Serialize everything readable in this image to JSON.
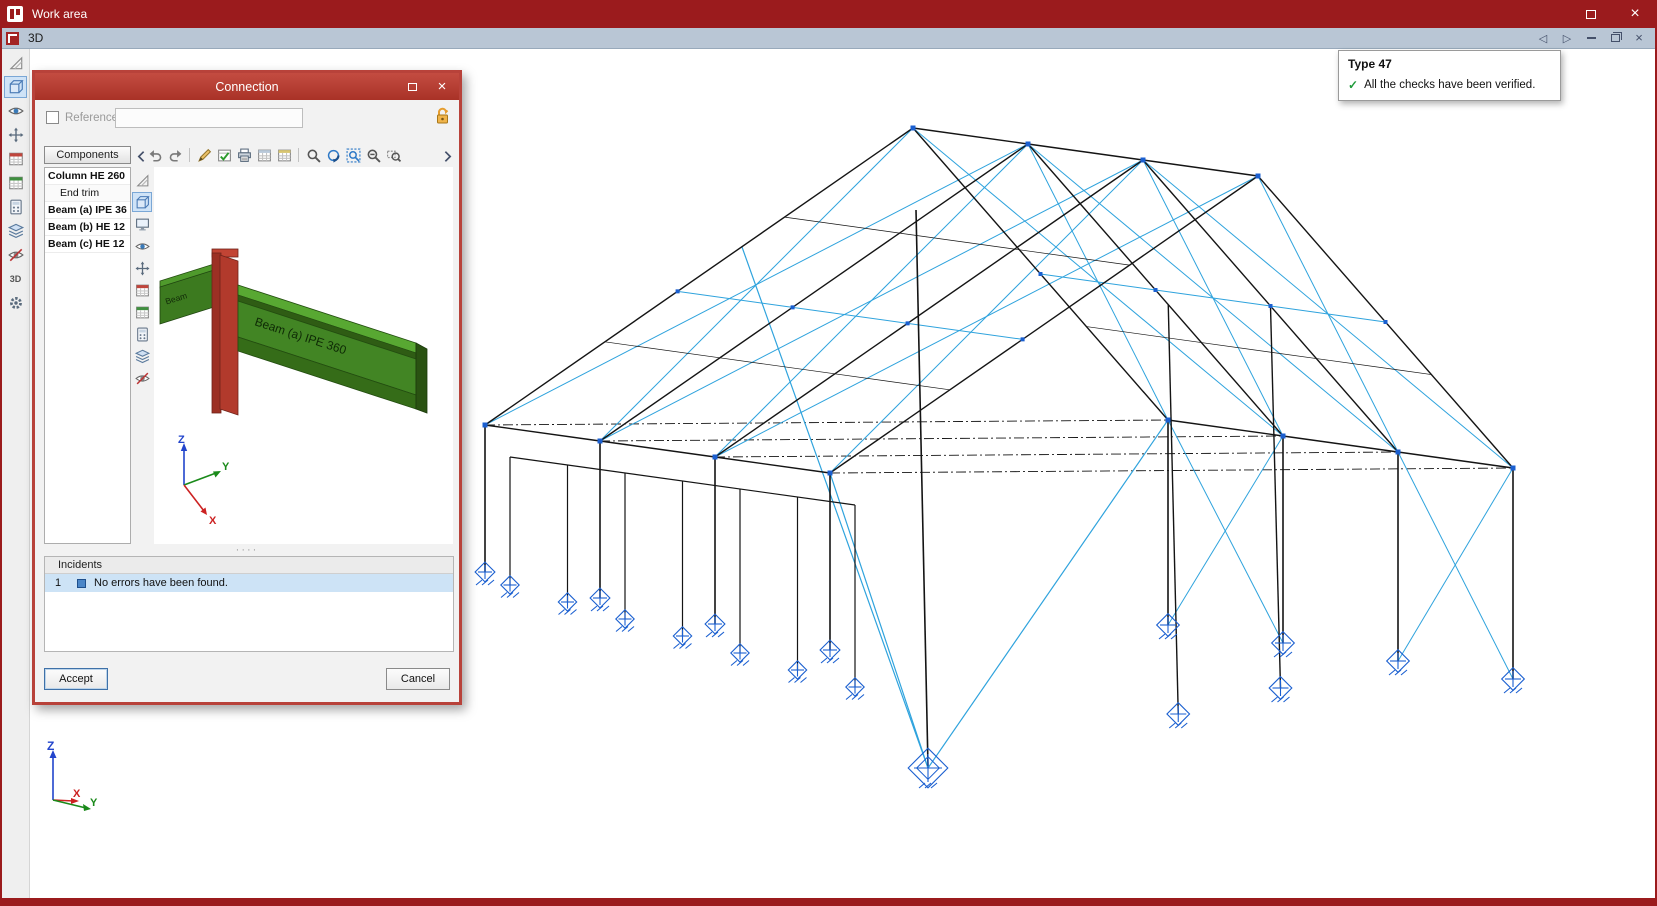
{
  "titlebar": {
    "title": "Work area"
  },
  "tabbar": {
    "active_tab": "3D"
  },
  "verification_tooltip": {
    "title": "Type 47",
    "check_icon": "✓",
    "message": "All the checks have been verified."
  },
  "axes": {
    "x": "X",
    "y": "Y",
    "z": "Z"
  },
  "left_toolbar": {
    "view3d_label": "3D"
  },
  "dialog": {
    "title": "Connection",
    "reference": {
      "label": "Reference",
      "value": "",
      "placeholder": ""
    },
    "components_header": "Components",
    "component_items": [
      {
        "label": "Column HE 260"
      },
      {
        "label": "End trim"
      },
      {
        "label": "Beam (a) IPE 36"
      },
      {
        "label": "Beam (b) HE 12"
      },
      {
        "label": "Beam (c) HE 12"
      }
    ],
    "preview": {
      "main_beam_label": "Beam (a) IPE 360",
      "secondary_beam_label": "Beam"
    },
    "incidents": {
      "header": "Incidents",
      "rows": [
        {
          "index": "1",
          "message": "No errors have been found."
        }
      ]
    },
    "buttons": {
      "accept": "Accept",
      "cancel": "Cancel"
    }
  },
  "colors": {
    "titlebar_red": "#9b1b1d",
    "dialog_red": "#b8423a",
    "structure_blue": "#1a5fd0",
    "structure_cyan": "#2fa3dd",
    "selection_blue": "#cde3f6",
    "model_green": "#3f7d22",
    "check_green": "#1f9b3a"
  },
  "icons": {
    "left_toolbar": [
      "triangle-ruler-icon",
      "cube-3d-icon",
      "eye-icon",
      "pan-icon",
      "report-red-icon",
      "report-green-icon",
      "calc-icon",
      "layers-icon",
      "visibility-off-icon",
      "view-3d-icon",
      "gear-icon"
    ],
    "dialog_toolbar": [
      "collapse-arrow-icon",
      "undo-icon",
      "redo-icon",
      "pencil-icon",
      "check-report-icon",
      "print-icon",
      "report-icon",
      "export-table-icon",
      "search-icon",
      "orbit-icon",
      "zoom-extents-icon",
      "zoom-out-icon",
      "zoom-window-icon",
      "expand-arrow-icon"
    ],
    "preview_toolbar": [
      "triangle-ruler-icon",
      "cube-3d-icon",
      "monitor-icon",
      "eye-icon",
      "pan-icon",
      "report-red-icon",
      "report-green-icon",
      "calc-icon",
      "layers-icon",
      "visibility-off-icon"
    ]
  }
}
